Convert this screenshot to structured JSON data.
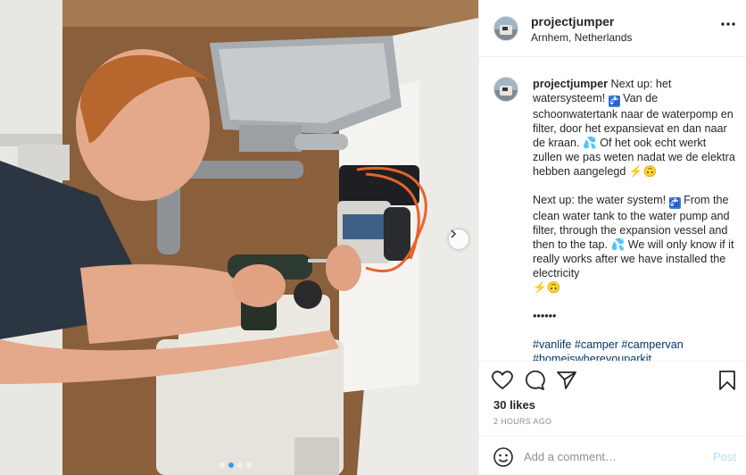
{
  "photo": {
    "description_icons": [
      "chevron-right-icon"
    ],
    "carousel": {
      "count": 4,
      "active_index": 1
    }
  },
  "post": {
    "username": "projectjumper",
    "location": "Arnhem, Netherlands",
    "caption": {
      "username": "projectjumper",
      "nl_1": "Next up: het watersysteem! ",
      "nl_2": " Van de schoonwatertank naar de waterpomp en filter, door het expansievat en dan naar de kraan. ",
      "nl_3": " Of het ook echt werkt zullen we pas weten nadat we de elektra hebben aangelegd ",
      "en_1": "Next up: the water system! ",
      "en_2": " From the clean water tank to the water pump and filter, through the expansion vessel and then to the tap. ",
      "en_3": " We will only know if it really works after we have installed the electricity ",
      "dots": "••••••",
      "hashtags": "#vanlife #camper #campervan #homeiswhereyouparkit"
    },
    "likes": "30 likes",
    "time": "2 HOURS AGO",
    "comment_placeholder": "Add a comment…",
    "post_label": "Post"
  },
  "colors": {
    "accent": "#3897f0",
    "post_disabled": "#b2dffc",
    "hashtag": "#00376b"
  }
}
